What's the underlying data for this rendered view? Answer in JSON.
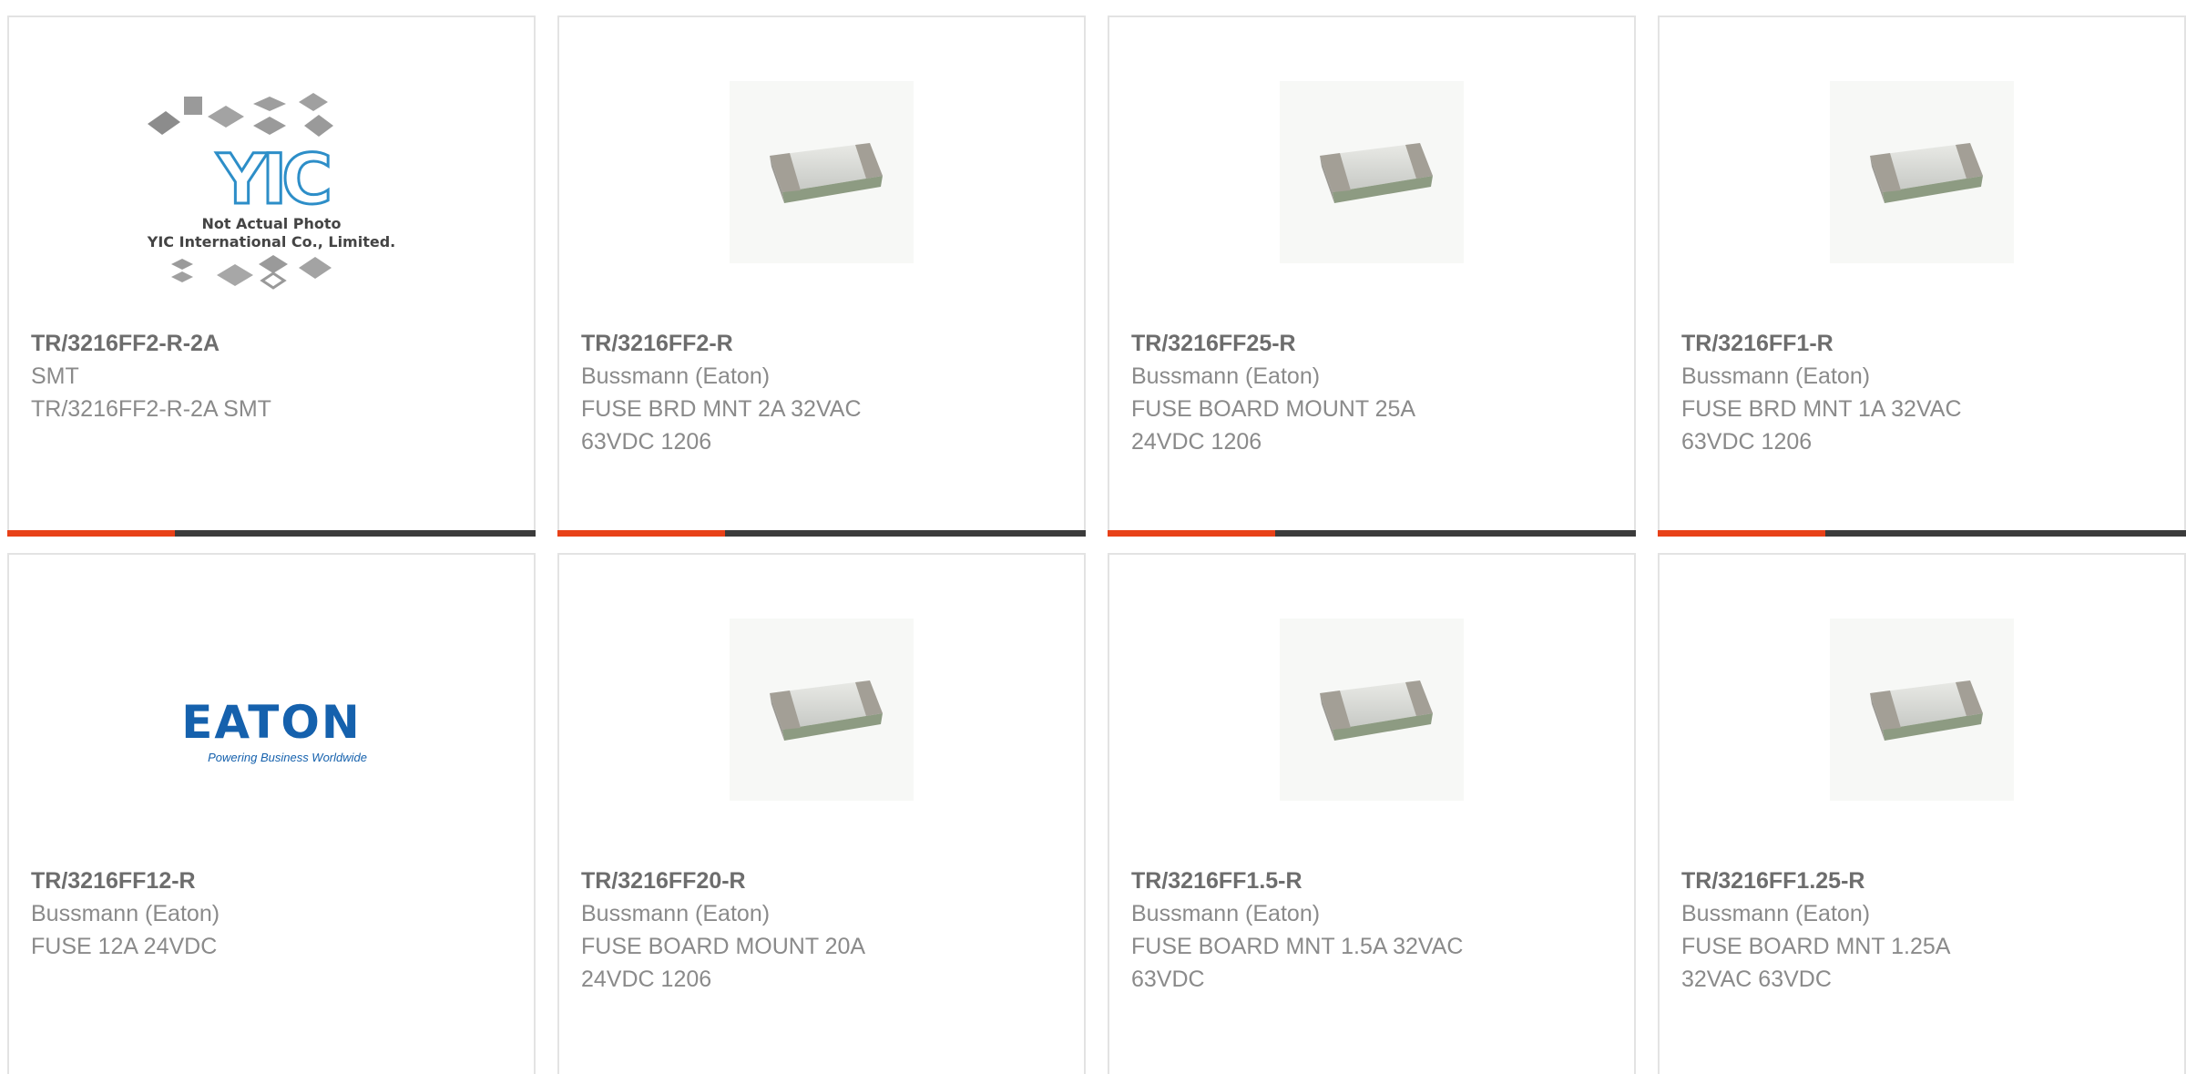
{
  "colors": {
    "accent": "#e84118",
    "bar": "#3b3b3b",
    "border": "#e3e3e3",
    "text": "#8a8a8a",
    "title": "#6d6d6d",
    "eaton_blue": "#1561ad",
    "yic_blue": "#2d8ec8"
  },
  "images": {
    "yic": {
      "logo": "YIC",
      "line1": "Not Actual Photo",
      "line2": "YIC International Co., Limited."
    },
    "eaton": {
      "word": "EATON",
      "tagline": "Powering Business Worldwide"
    }
  },
  "products": [
    {
      "part": "TR/3216FF2-R-2A",
      "maker": "SMT",
      "desc": "TR/3216FF2-R-2A SMT",
      "image": "yic-placeholder-icon"
    },
    {
      "part": "TR/3216FF2-R",
      "maker": "Bussmann (Eaton)",
      "desc": "FUSE BRD MNT 2A 32VAC\n63VDC 1206",
      "image": "smd-fuse-chip-icon"
    },
    {
      "part": "TR/3216FF25-R",
      "maker": "Bussmann (Eaton)",
      "desc": "FUSE BOARD MOUNT 25A\n24VDC 1206",
      "image": "smd-fuse-chip-icon"
    },
    {
      "part": "TR/3216FF1-R",
      "maker": "Bussmann (Eaton)",
      "desc": "FUSE BRD MNT 1A 32VAC\n63VDC 1206",
      "image": "smd-fuse-chip-icon"
    },
    {
      "part": "TR/3216FF12-R",
      "maker": "Bussmann (Eaton)",
      "desc": "FUSE 12A 24VDC",
      "image": "eaton-logo-icon"
    },
    {
      "part": "TR/3216FF20-R",
      "maker": "Bussmann (Eaton)",
      "desc": "FUSE BOARD MOUNT 20A\n24VDC 1206",
      "image": "smd-fuse-chip-icon"
    },
    {
      "part": "TR/3216FF1.5-R",
      "maker": "Bussmann (Eaton)",
      "desc": "FUSE BOARD MNT 1.5A 32VAC\n63VDC",
      "image": "smd-fuse-chip-icon"
    },
    {
      "part": "TR/3216FF1.25-R",
      "maker": "Bussmann (Eaton)",
      "desc": "FUSE BOARD MNT 1.25A\n32VAC 63VDC",
      "image": "smd-fuse-chip-icon"
    }
  ]
}
